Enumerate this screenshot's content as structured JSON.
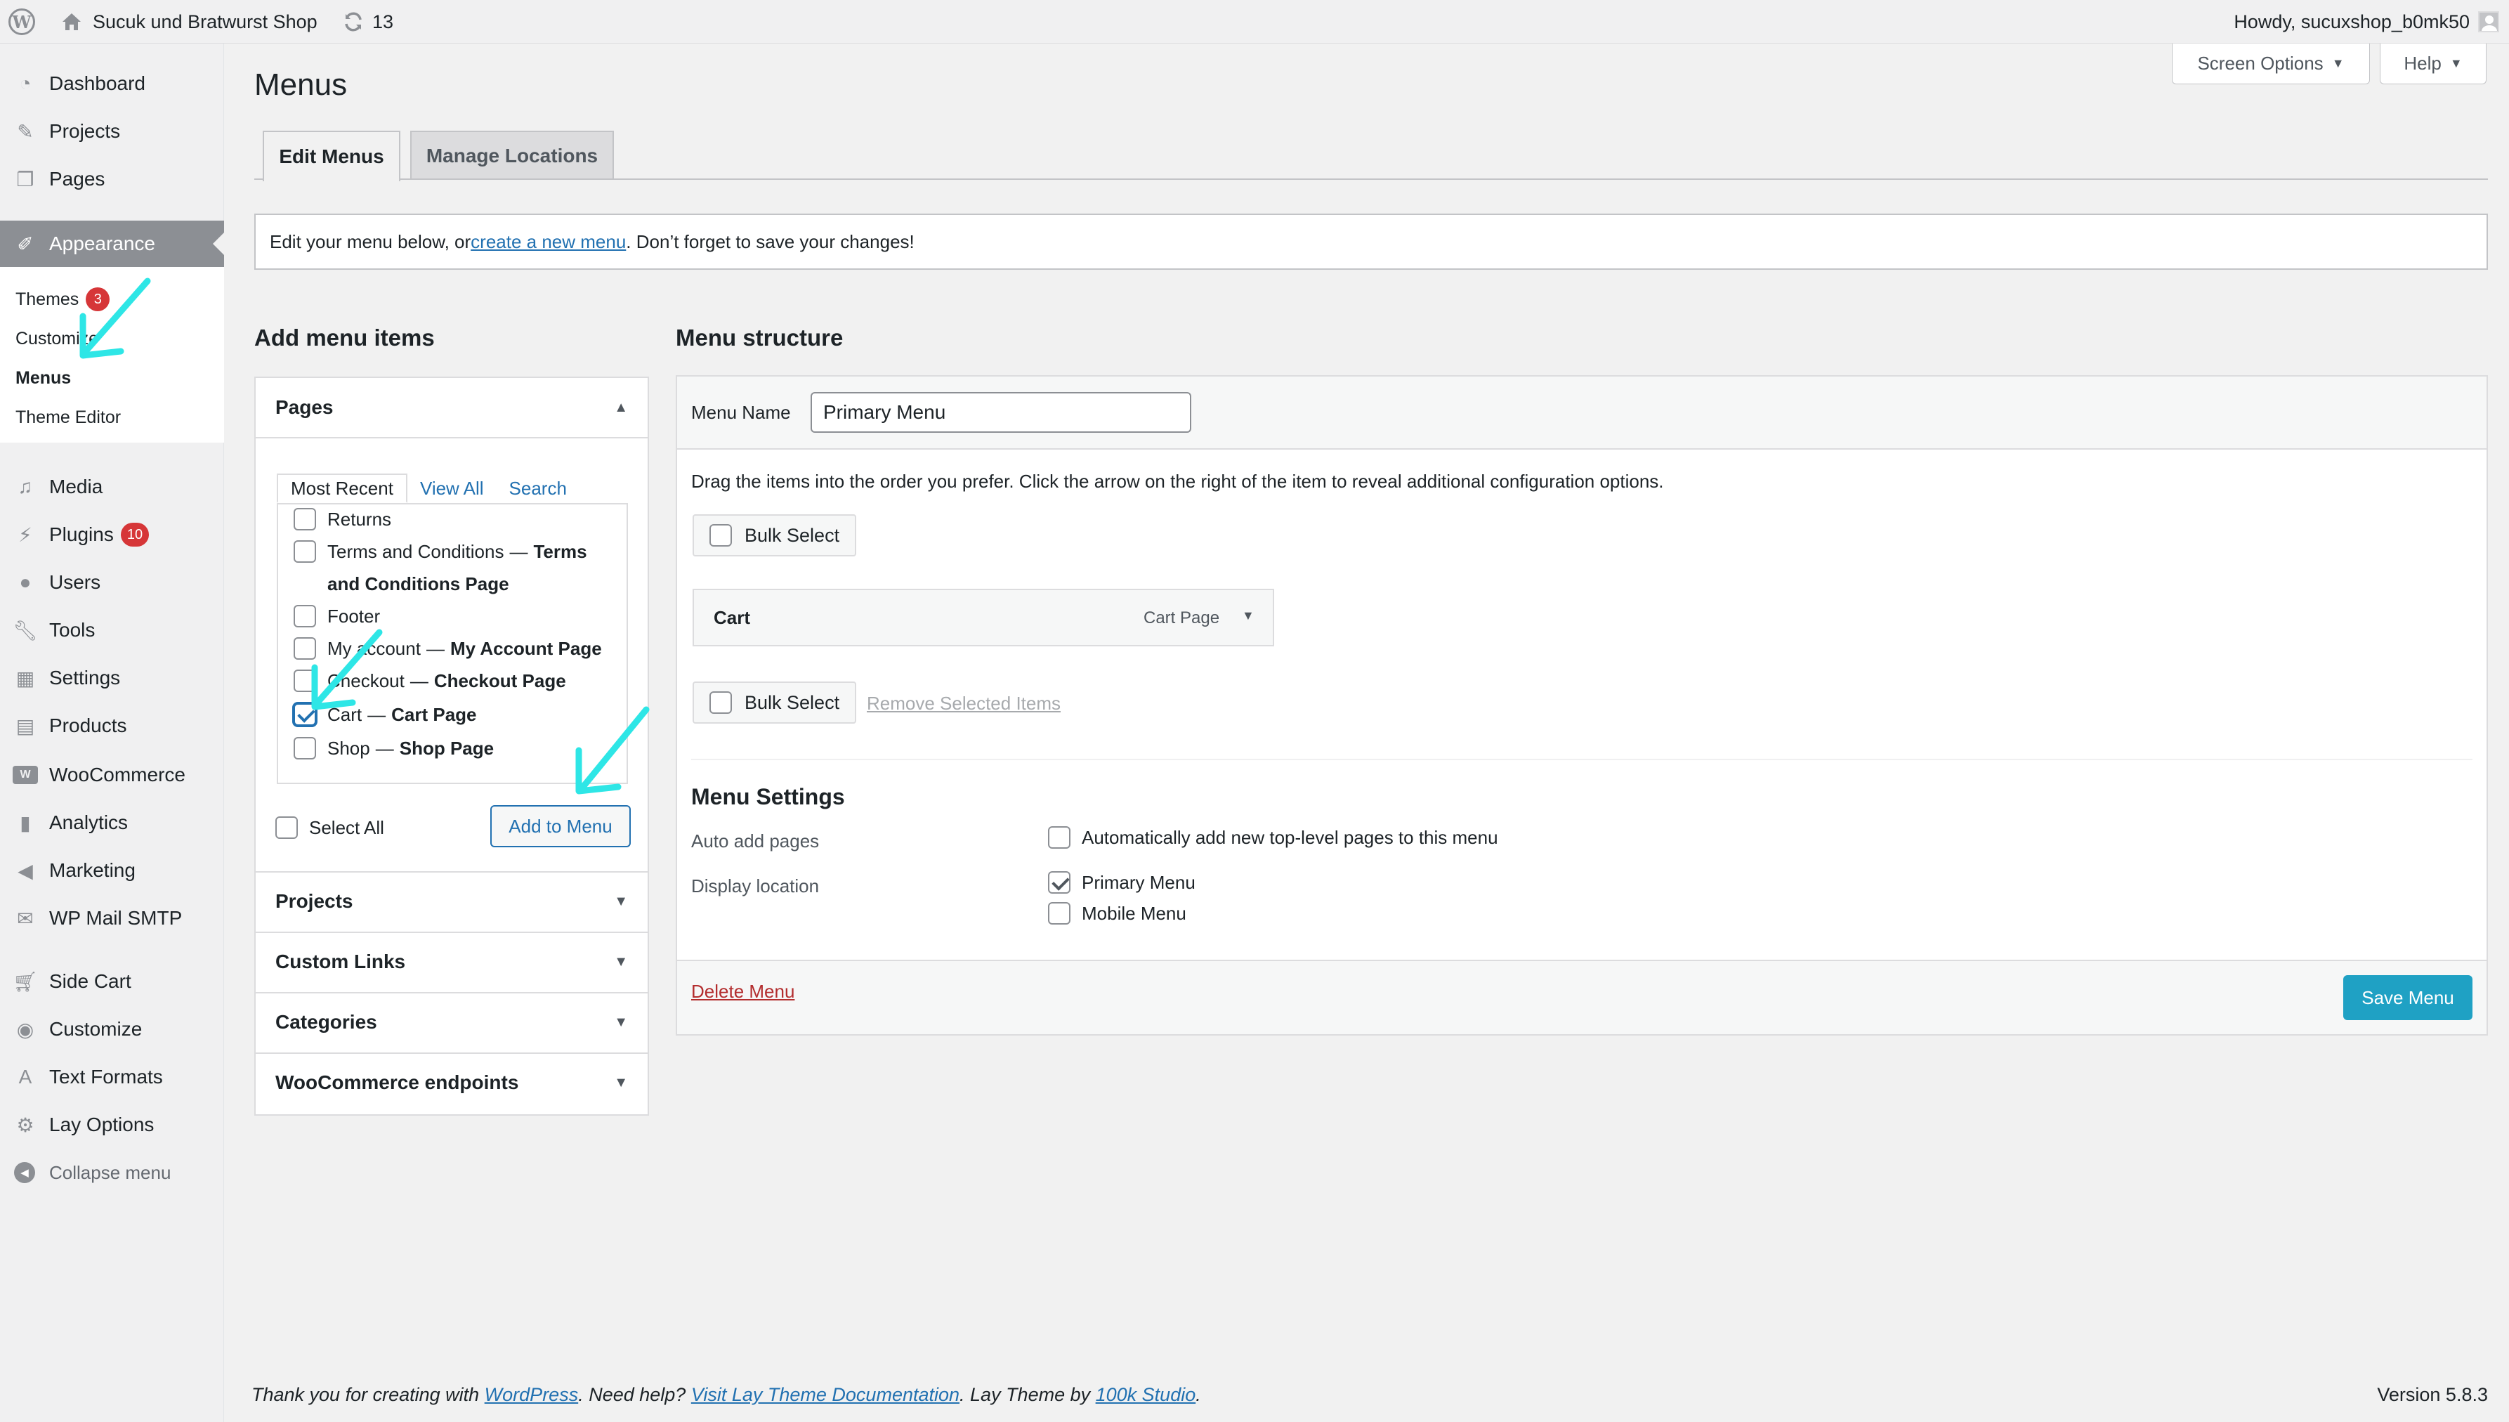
{
  "adminbar": {
    "site_name": "Sucuk und Bratwurst Shop",
    "updates_count": "13",
    "howdy": "Howdy, sucuxshop_b0mk50"
  },
  "sidebar": {
    "items": [
      {
        "label": "Dashboard",
        "icon": "dashboard-icon"
      },
      {
        "label": "Projects",
        "icon": "pin-icon"
      },
      {
        "label": "Pages",
        "icon": "pages-icon"
      },
      {
        "label": "Appearance",
        "icon": "brush-icon"
      },
      {
        "label": "Media",
        "icon": "media-icon"
      },
      {
        "label": "Plugins",
        "icon": "plugin-icon",
        "badge": "10"
      },
      {
        "label": "Users",
        "icon": "users-icon"
      },
      {
        "label": "Tools",
        "icon": "wrench-icon"
      },
      {
        "label": "Settings",
        "icon": "settings-icon"
      },
      {
        "label": "Products",
        "icon": "archive-icon"
      },
      {
        "label": "WooCommerce",
        "icon": "woo-icon"
      },
      {
        "label": "Analytics",
        "icon": "chart-icon"
      },
      {
        "label": "Marketing",
        "icon": "megaphone-icon"
      },
      {
        "label": "WP Mail SMTP",
        "icon": "mail-icon"
      },
      {
        "label": "Side Cart",
        "icon": "cart-icon"
      },
      {
        "label": "Customize",
        "icon": "eye-icon"
      },
      {
        "label": "Text Formats",
        "icon": "text-icon"
      },
      {
        "label": "Lay Options",
        "icon": "gear-icon"
      }
    ],
    "submenu": {
      "themes": "Themes",
      "themes_badge": "3",
      "customize": "Customize",
      "menus": "Menus",
      "theme_editor": "Theme Editor"
    },
    "collapse": "Collapse menu"
  },
  "screen_options": "Screen Options",
  "help": "Help",
  "page_title": "Menus",
  "tabs": {
    "edit": "Edit Menus",
    "manage": "Manage Locations"
  },
  "notice": {
    "before": "Edit your menu below, or ",
    "link": "create a new menu",
    "after": ". Don’t forget to save your changes!"
  },
  "add_items": {
    "heading": "Add menu items",
    "pages": {
      "title": "Pages",
      "tabs": [
        "Most Recent",
        "View All",
        "Search"
      ],
      "items": [
        {
          "title": "Returns",
          "state": "",
          "checked": false
        },
        {
          "title": "Terms and Conditions",
          "state": "Terms and Conditions Page",
          "checked": false
        },
        {
          "title": "Footer",
          "state": "",
          "checked": false
        },
        {
          "title": "My account",
          "state": "My Account Page",
          "checked": false
        },
        {
          "title": "Checkout",
          "state": "Checkout Page",
          "checked": false
        },
        {
          "title": "Cart",
          "state": "Cart Page",
          "checked": true
        },
        {
          "title": "Shop",
          "state": "Shop Page",
          "checked": false
        }
      ],
      "select_all": "Select All",
      "add_button": "Add to Menu"
    },
    "other_sections": [
      "Projects",
      "Custom Links",
      "Categories",
      "WooCommerce endpoints"
    ]
  },
  "structure": {
    "heading": "Menu structure",
    "menu_name_label": "Menu Name",
    "menu_name_value": "Primary Menu",
    "instructions": "Drag the items into the order you prefer. Click the arrow on the right of the item to reveal additional configuration options.",
    "bulk_select": "Bulk Select",
    "item": {
      "title": "Cart",
      "type": "Cart Page"
    },
    "remove_selected": "Remove Selected Items",
    "settings_heading": "Menu Settings",
    "auto_add_label": "Auto add pages",
    "auto_add_option": "Automatically add new top-level pages to this menu",
    "display_location_label": "Display location",
    "locations": [
      {
        "label": "Primary Menu",
        "checked": true
      },
      {
        "label": "Mobile Menu",
        "checked": false
      }
    ],
    "delete": "Delete Menu",
    "save": "Save Menu"
  },
  "footer": {
    "thanks_before": "Thank you for creating with ",
    "wordpress_link": "WordPress",
    "help_text": ". Need help? ",
    "docs_link": "Visit Lay Theme Documentation",
    "by_text": ". Lay Theme by ",
    "studio_link": "100k Studio",
    "end": ".",
    "version": "Version 5.8.3"
  },
  "colors": {
    "accent": "#2271b1",
    "save_button": "#1fa1c4",
    "annotation_arrow": "#2ee6e6",
    "badge": "#d63638",
    "delete": "#b32d2e"
  }
}
